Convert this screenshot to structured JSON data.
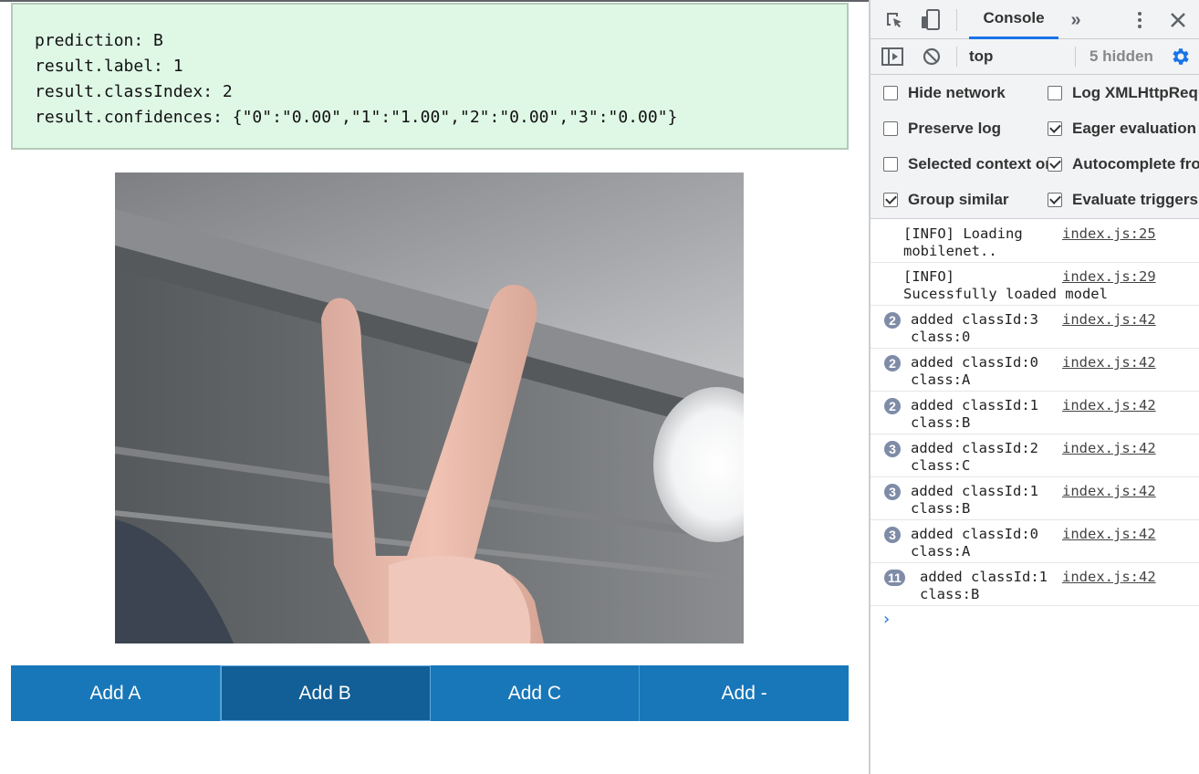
{
  "prediction": {
    "lines": [
      "prediction: B",
      "result.label: 1",
      "result.classIndex: 2",
      "result.confidences: {\"0\":\"0.00\",\"1\":\"1.00\",\"2\":\"0.00\",\"3\":\"0.00\"}"
    ]
  },
  "buttons": [
    {
      "label": "Add A"
    },
    {
      "label": "Add B"
    },
    {
      "label": "Add C"
    },
    {
      "label": "Add -"
    }
  ],
  "devtools": {
    "icons": [
      "inspect-element-icon",
      "device-toolbar-icon",
      "more-tabs-icon",
      "kebab-menu-icon",
      "close-icon",
      "sidebar-toggle-icon",
      "clear-console-icon",
      "settings-gear-icon"
    ],
    "active_tab": "Console",
    "context": "top",
    "hidden": "5 hidden",
    "settings": [
      {
        "label": "Hide network",
        "checked": false
      },
      {
        "label": "Log XMLHttpRequests",
        "checked": false
      },
      {
        "label": "Preserve log",
        "checked": false
      },
      {
        "label": "Eager evaluation",
        "checked": true
      },
      {
        "label": "Selected context only",
        "checked": false
      },
      {
        "label": "Autocomplete from history",
        "checked": true
      },
      {
        "label": "Group similar",
        "checked": true
      },
      {
        "label": "Evaluate triggers user activation",
        "checked": true
      }
    ],
    "accent_color": "#1a73e8",
    "log": [
      {
        "count": "",
        "message": "[INFO] Loading\nmobilenet..",
        "source": "index.js:25"
      },
      {
        "count": "",
        "message": "[INFO]\nSucessfully loaded model",
        "source": "index.js:29"
      },
      {
        "count": "2",
        "message": "added classId:3\nclass:0",
        "source": "index.js:42"
      },
      {
        "count": "2",
        "message": "added classId:0\nclass:A",
        "source": "index.js:42"
      },
      {
        "count": "2",
        "message": "added classId:1\nclass:B",
        "source": "index.js:42"
      },
      {
        "count": "3",
        "message": "added classId:2\nclass:C",
        "source": "index.js:42"
      },
      {
        "count": "3",
        "message": "added classId:1\nclass:B",
        "source": "index.js:42"
      },
      {
        "count": "3",
        "message": "added classId:0\nclass:A",
        "source": "index.js:42"
      },
      {
        "count": "11",
        "message": "added classId:1\nclass:B",
        "source": "index.js:42"
      }
    ],
    "prompt": "›"
  },
  "colors": {
    "prediction_bg": "#dff8e6",
    "button_bg": "#1877b8",
    "button_active_bg": "#125e96"
  }
}
